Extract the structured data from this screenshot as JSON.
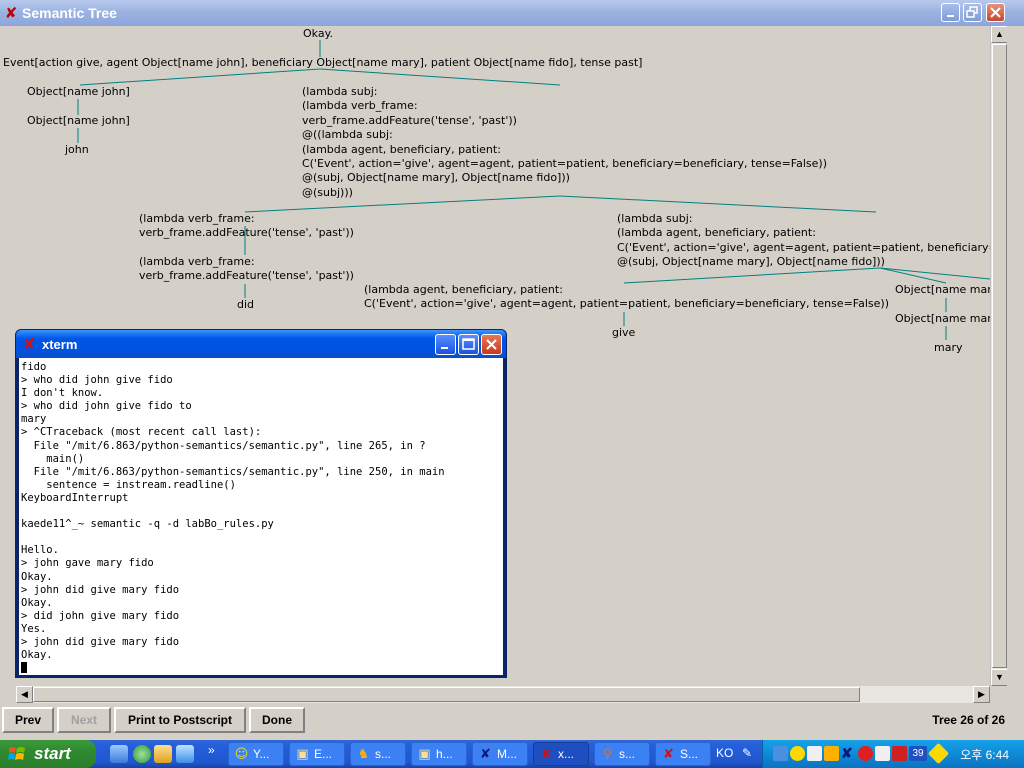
{
  "tree_window": {
    "title": "Semantic Tree",
    "status": "Tree 26 of 26",
    "buttons": {
      "prev": "Prev",
      "next": "Next",
      "print": "Print to Postscript",
      "done": "Done"
    }
  },
  "tree": {
    "root": "Okay.",
    "event": "Event[action give, agent Object[name john], beneficiary Object[name mary], patient Object[name fido], tense past]",
    "agent_1": "Object[name john]",
    "agent_2": "Object[name john]",
    "agent_word": "john",
    "big_lambda": "(lambda subj:\n(lambda verb_frame:\nverb_frame.addFeature('tense', 'past'))\n@((lambda subj:\n(lambda agent, beneficiary, patient:\nC('Event', action='give', agent=agent, patient=patient, beneficiary=beneficiary, tense=False))\n@(subj, Object[name mary], Object[name fido]))\n@(subj)))",
    "tense_1": "(lambda verb_frame:\nverb_frame.addFeature('tense', 'past'))",
    "tense_2": "(lambda verb_frame:\nverb_frame.addFeature('tense', 'past'))",
    "did_word": "did",
    "subj_lambda": "(lambda subj:\n(lambda agent, beneficiary, patient:\nC('Event', action='give', agent=agent, patient=patient, beneficiary=\n@(subj, Object[name mary], Object[name fido]))",
    "give_lambda": "(lambda agent, beneficiary, patient:\nC('Event', action='give', agent=agent, patient=patient, beneficiary=beneficiary, tense=False))",
    "give_word": "give",
    "mary_1": "Object[name mar",
    "mary_2": "Object[name mar",
    "mary_word": "mary"
  },
  "xterm": {
    "title": "xterm",
    "output": "fido\n> who did john give fido\nI don't know.\n> who did john give fido to\nmary\n> ^CTraceback (most recent call last):\n  File \"/mit/6.863/python-semantics/semantic.py\", line 265, in ?\n    main()\n  File \"/mit/6.863/python-semantics/semantic.py\", line 250, in main\n    sentence = instream.readline()\nKeyboardInterrupt\n\nkaede11^_~ semantic -q -d labBo_rules.py\n\nHello.\n> john gave mary fido\nOkay.\n> john did give mary fido\nOkay.\n> did john give mary fido\nYes.\n> john did give mary fido\nOkay."
  },
  "taskbar": {
    "start": "start",
    "tasks": [
      {
        "label": "Y...",
        "icon": "smiley-icon"
      },
      {
        "label": "E...",
        "icon": "explorer-icon"
      },
      {
        "label": "s...",
        "icon": "runner-icon"
      },
      {
        "label": "h...",
        "icon": "window-icon"
      },
      {
        "label": "M...",
        "icon": "x-icon"
      },
      {
        "label": "x...",
        "icon": "x-icon"
      },
      {
        "label": "s...",
        "icon": "figure-icon"
      },
      {
        "label": "S...",
        "icon": "x-icon"
      }
    ],
    "lang": "KO",
    "clock": "오후 6:44",
    "tray_badge": "39"
  },
  "colors": {
    "tree_edge": "#008080",
    "xp_blue": "#245edc",
    "start_green": "#2f8a2f"
  }
}
